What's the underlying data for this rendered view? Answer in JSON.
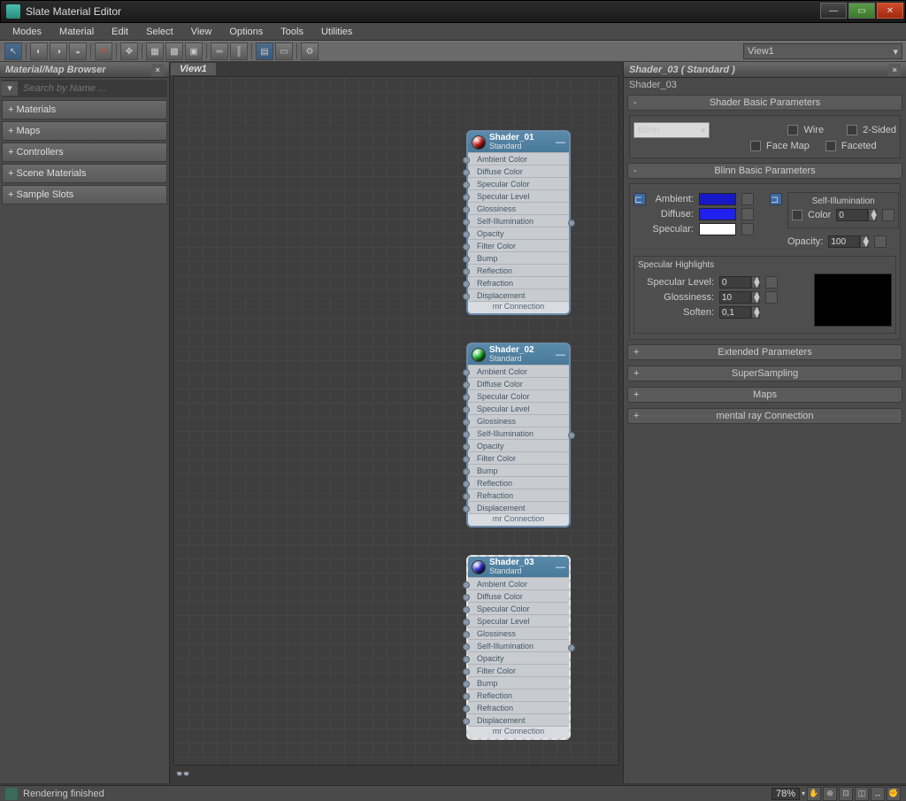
{
  "window": {
    "title": "Slate Material Editor"
  },
  "menubar": [
    "Modes",
    "Material",
    "Edit",
    "Select",
    "View",
    "Options",
    "Tools",
    "Utilities"
  ],
  "toolbar": {
    "view_combo": "View1"
  },
  "left": {
    "title": "Material/Map Browser",
    "search_placeholder": "Search by Name ...",
    "categories": [
      "+ Materials",
      "+ Maps",
      "+ Controllers",
      "+ Scene Materials",
      "+ Sample Slots"
    ]
  },
  "view": {
    "tab": "View1"
  },
  "nodes": [
    {
      "name": "Shader_01",
      "type": "Standard",
      "color": "#d02020",
      "selected": false
    },
    {
      "name": "Shader_02",
      "type": "Standard",
      "color": "#20c030",
      "selected": false
    },
    {
      "name": "Shader_03",
      "type": "Standard",
      "color": "#3030d0",
      "selected": true
    }
  ],
  "node_slots": [
    "Ambient Color",
    "Diffuse Color",
    "Specular Color",
    "Specular Level",
    "Glossiness",
    "Self-Illumination",
    "Opacity",
    "Filter Color",
    "Bump",
    "Reflection",
    "Refraction",
    "Displacement"
  ],
  "node_mr": "mr Connection",
  "right": {
    "hdr": "Shader_03  ( Standard )",
    "name": "Shader_03",
    "roll_basic": "Shader Basic Parameters",
    "shader_type": "Blinn",
    "wire": "Wire",
    "twosided": "2-Sided",
    "facemap": "Face Map",
    "faceted": "Faceted",
    "roll_blinn": "Blinn Basic Parameters",
    "ambient": "Ambient:",
    "diffuse": "Diffuse:",
    "specular": "Specular:",
    "ambient_color": "#1818c8",
    "diffuse_color": "#2020f0",
    "specular_color": "#ffffff",
    "selfillum": "Self-Illumination",
    "color_lbl": "Color",
    "color_val": "0",
    "opacity_lbl": "Opacity:",
    "opacity_val": "100",
    "spec_h": "Specular Highlights",
    "speclevel_lbl": "Specular Level:",
    "speclevel_val": "0",
    "gloss_lbl": "Glossiness:",
    "gloss_val": "10",
    "soften_lbl": "Soften:",
    "soften_val": "0,1",
    "roll_ext": "Extended Parameters",
    "roll_ss": "SuperSampling",
    "roll_maps": "Maps",
    "roll_mr": "mental ray Connection"
  },
  "status": {
    "text": "Rendering finished",
    "zoom": "78%"
  }
}
